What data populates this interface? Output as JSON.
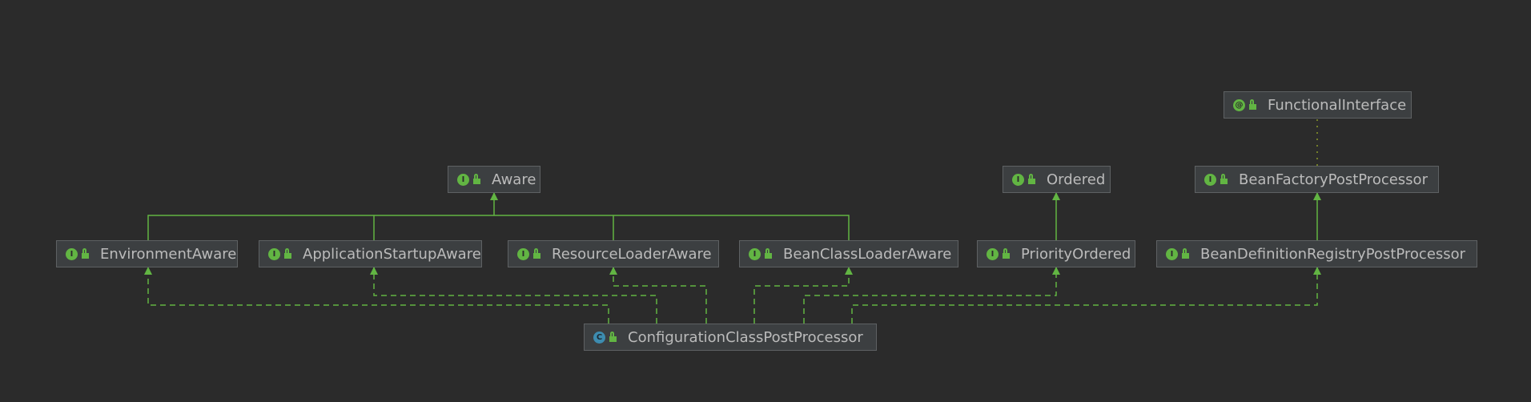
{
  "diagram": {
    "nodes": [
      {
        "id": "functional-interface",
        "label": "FunctionalInterface",
        "kind": "annotation",
        "icon": "annotation-icon"
      },
      {
        "id": "aware",
        "label": "Aware",
        "kind": "interface",
        "icon": "interface-icon"
      },
      {
        "id": "ordered",
        "label": "Ordered",
        "kind": "interface",
        "icon": "interface-icon"
      },
      {
        "id": "bean-factory-post-processor",
        "label": "BeanFactoryPostProcessor",
        "kind": "interface",
        "icon": "interface-icon"
      },
      {
        "id": "environment-aware",
        "label": "EnvironmentAware",
        "kind": "interface",
        "icon": "interface-icon"
      },
      {
        "id": "application-startup-aware",
        "label": "ApplicationStartupAware",
        "kind": "interface",
        "icon": "interface-icon"
      },
      {
        "id": "resource-loader-aware",
        "label": "ResourceLoaderAware",
        "kind": "interface",
        "icon": "interface-icon"
      },
      {
        "id": "bean-class-loader-aware",
        "label": "BeanClassLoaderAware",
        "kind": "interface",
        "icon": "interface-icon"
      },
      {
        "id": "priority-ordered",
        "label": "PriorityOrdered",
        "kind": "interface",
        "icon": "interface-icon"
      },
      {
        "id": "bean-definition-registry-post-processor",
        "label": "BeanDefinitionRegistryPostProcessor",
        "kind": "interface",
        "icon": "interface-icon"
      },
      {
        "id": "configuration-class-post-processor",
        "label": "ConfigurationClassPostProcessor",
        "kind": "class",
        "icon": "class-icon"
      }
    ],
    "edges": [
      {
        "from": "environment-aware",
        "to": "aware",
        "type": "extends"
      },
      {
        "from": "application-startup-aware",
        "to": "aware",
        "type": "extends"
      },
      {
        "from": "resource-loader-aware",
        "to": "aware",
        "type": "extends"
      },
      {
        "from": "bean-class-loader-aware",
        "to": "aware",
        "type": "extends"
      },
      {
        "from": "priority-ordered",
        "to": "ordered",
        "type": "extends"
      },
      {
        "from": "bean-definition-registry-post-processor",
        "to": "bean-factory-post-processor",
        "type": "extends"
      },
      {
        "from": "bean-factory-post-processor",
        "to": "functional-interface",
        "type": "annotated"
      },
      {
        "from": "configuration-class-post-processor",
        "to": "environment-aware",
        "type": "implements"
      },
      {
        "from": "configuration-class-post-processor",
        "to": "application-startup-aware",
        "type": "implements"
      },
      {
        "from": "configuration-class-post-processor",
        "to": "resource-loader-aware",
        "type": "implements"
      },
      {
        "from": "configuration-class-post-processor",
        "to": "bean-class-loader-aware",
        "type": "implements"
      },
      {
        "from": "configuration-class-post-processor",
        "to": "priority-ordered",
        "type": "implements"
      },
      {
        "from": "configuration-class-post-processor",
        "to": "bean-definition-registry-post-processor",
        "type": "implements"
      }
    ]
  },
  "colors": {
    "background": "#2b2b2b",
    "node_fill": "#3c3f41",
    "node_border": "#5e6163",
    "text": "#bbbbbb",
    "edge": "#62b543",
    "annotation_edge": "#8a9a2a",
    "class_icon": "#3d8cb0",
    "interface_icon": "#62b543"
  },
  "icon_letters": {
    "interface": "I",
    "class": "C",
    "annotation": "@"
  }
}
